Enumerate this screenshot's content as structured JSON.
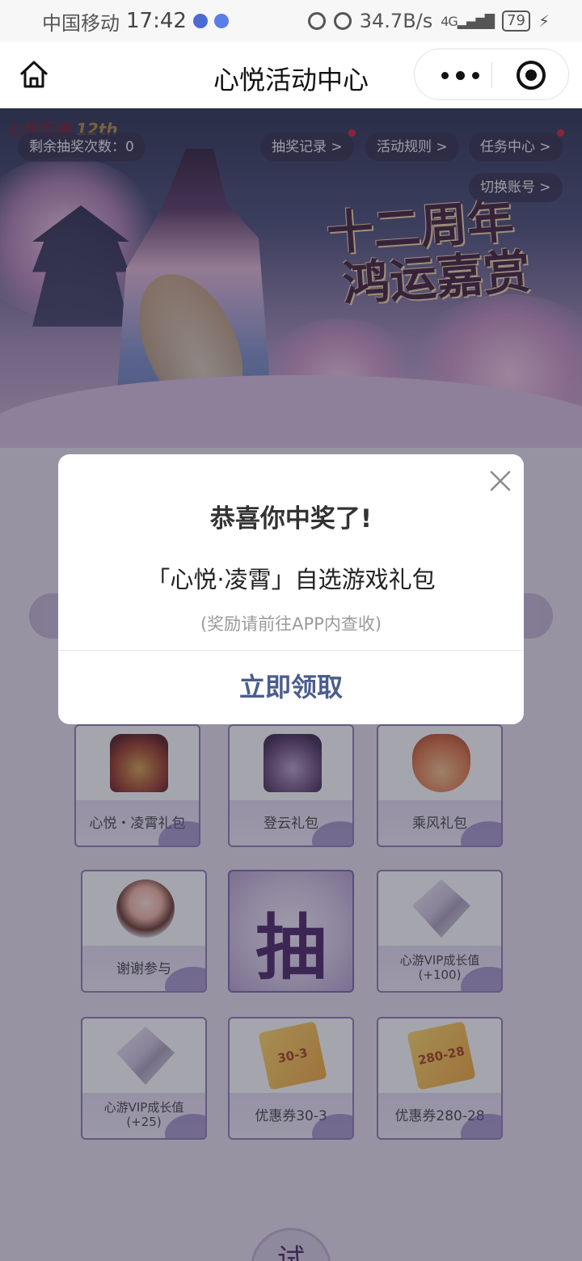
{
  "status_bar": {
    "carrier": "中国移动",
    "time": "17:42",
    "net_speed": "34.7B/s",
    "network": "4G",
    "battery": "79"
  },
  "nav": {
    "title": "心悦活动中心"
  },
  "banner": {
    "brand": "心悦互娱",
    "brand_badge": "12th",
    "headline_line1": "十二周年",
    "headline_line2": "鸿运嘉赏",
    "remaining_label": "剩余抽奖次数：0",
    "buttons": {
      "records": "抽奖记录 >",
      "rules": "活动规则 >",
      "tasks": "任务中心 >",
      "switch_account": "切换账号 >"
    }
  },
  "prizes": [
    {
      "label": "心悦・凌霄礼包",
      "icon": "gold-chest-icon"
    },
    {
      "label": "登云礼包",
      "icon": "purple-chest-icon"
    },
    {
      "label": "乘风礼包",
      "icon": "lucky-bag-icon"
    },
    {
      "label": "谢谢参与",
      "icon": "girl-mascot-icon"
    },
    {
      "label": "抽",
      "icon": "draw-button"
    },
    {
      "label": "心游VIP成长值\n(+100)",
      "icon": "crystal-icon"
    },
    {
      "label": "心游VIP成长值\n(+25)",
      "icon": "crystal-icon"
    },
    {
      "label": "优惠券30-3",
      "icon": "coupon-icon",
      "ticket_text": "30-3"
    },
    {
      "label": "优惠券280-28",
      "icon": "coupon-icon",
      "ticket_text": "280-28"
    }
  ],
  "bottom_button": {
    "label": "试"
  },
  "dialog": {
    "title": "恭喜你中奖了!",
    "prize": "「心悦·凌霄」自选游戏礼包",
    "note": "(奖励请前往APP内查收)",
    "action": "立即领取"
  },
  "colors": {
    "accent": "#4a5d8e",
    "card_border": "#8f7db6",
    "draw_text": "#4a2666"
  }
}
